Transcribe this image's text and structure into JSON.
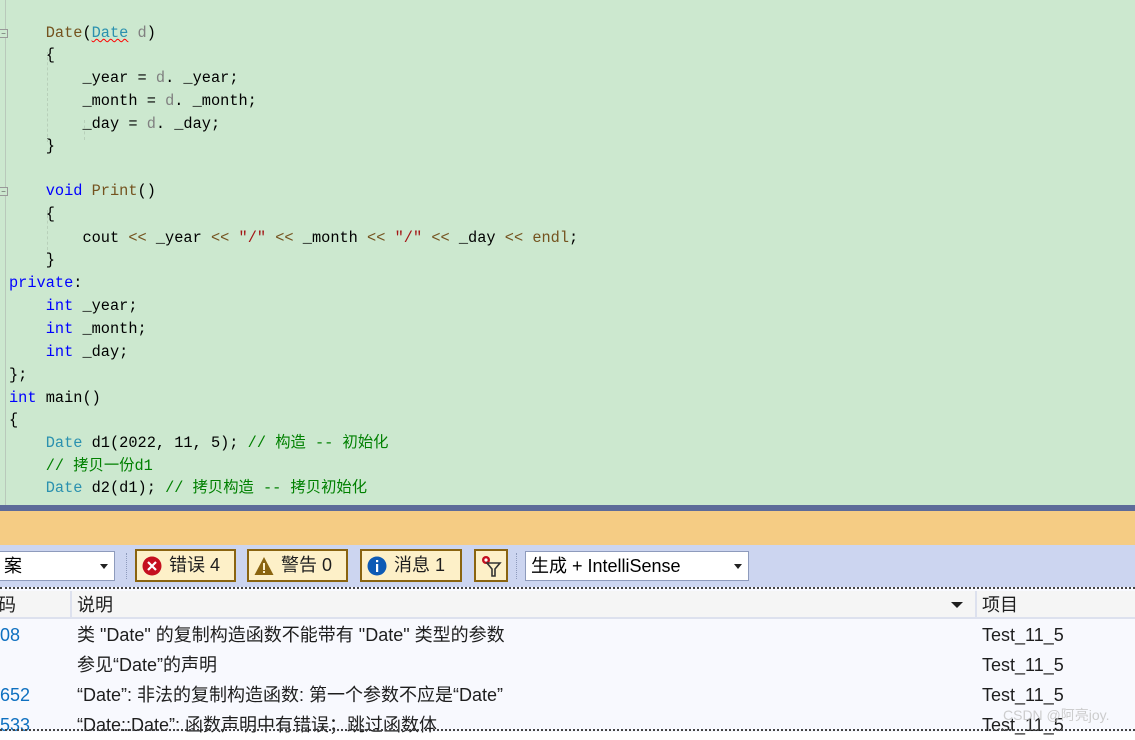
{
  "editor": {
    "lines": [
      {
        "tokens": [
          [
            "fn",
            "Date"
          ],
          [
            "",
            "("
          ],
          [
            "ty squig",
            "Date"
          ],
          [
            "pa",
            " d"
          ],
          [
            "",
            ")"
          ]
        ],
        "indent": "    "
      },
      {
        "tokens": [
          [
            "",
            "{"
          ]
        ],
        "indent": "    "
      },
      {
        "tokens": [
          [
            "",
            "_year = "
          ],
          [
            "pa",
            "d"
          ],
          [
            "",
            ". _year;"
          ]
        ],
        "indent": "        "
      },
      {
        "tokens": [
          [
            "",
            "_month = "
          ],
          [
            "pa",
            "d"
          ],
          [
            "",
            ". _month;"
          ]
        ],
        "indent": "        "
      },
      {
        "tokens": [
          [
            "",
            "_day = "
          ],
          [
            "pa",
            "d"
          ],
          [
            "",
            ". _day;"
          ]
        ],
        "indent": "        "
      },
      {
        "tokens": [
          [
            "",
            "}"
          ]
        ],
        "indent": "    "
      },
      {
        "tokens": [],
        "indent": ""
      },
      {
        "tokens": [
          [
            "kw",
            "void"
          ],
          [
            "",
            " "
          ],
          [
            "fn",
            "Print"
          ],
          [
            "",
            "()"
          ]
        ],
        "indent": "    "
      },
      {
        "tokens": [
          [
            "",
            "{"
          ]
        ],
        "indent": "    "
      },
      {
        "tokens": [
          [
            "",
            "cout "
          ],
          [
            "fn",
            "<<"
          ],
          [
            "",
            " _year "
          ],
          [
            "fn",
            "<<"
          ],
          [
            "",
            " "
          ],
          [
            "st",
            "\"/\""
          ],
          [
            "",
            " "
          ],
          [
            "fn",
            "<<"
          ],
          [
            "",
            " _month "
          ],
          [
            "fn",
            "<<"
          ],
          [
            "",
            " "
          ],
          [
            "st",
            "\"/\""
          ],
          [
            "",
            " "
          ],
          [
            "fn",
            "<<"
          ],
          [
            "",
            " _day "
          ],
          [
            "fn",
            "<<"
          ],
          [
            "",
            " "
          ],
          [
            "fn",
            "endl"
          ],
          [
            "",
            ";"
          ]
        ],
        "indent": "        "
      },
      {
        "tokens": [
          [
            "",
            "}"
          ]
        ],
        "indent": "    "
      },
      {
        "tokens": [
          [
            "kw",
            "private"
          ],
          [
            "",
            ":"
          ]
        ],
        "indent": ""
      },
      {
        "tokens": [
          [
            "kw",
            "int"
          ],
          [
            "",
            " _year;"
          ]
        ],
        "indent": "    "
      },
      {
        "tokens": [
          [
            "kw",
            "int"
          ],
          [
            "",
            " _month;"
          ]
        ],
        "indent": "    "
      },
      {
        "tokens": [
          [
            "kw",
            "int"
          ],
          [
            "",
            " _day;"
          ]
        ],
        "indent": "    "
      },
      {
        "tokens": [
          [
            "",
            "};"
          ]
        ],
        "indent": ""
      },
      {
        "tokens": [
          [
            "kw",
            "int"
          ],
          [
            "",
            " main()"
          ]
        ],
        "indent": ""
      },
      {
        "tokens": [
          [
            "",
            "{"
          ]
        ],
        "indent": ""
      },
      {
        "tokens": [
          [
            "ty",
            "Date"
          ],
          [
            "",
            " d1(2022, 11, 5); "
          ],
          [
            "cm",
            "// 构造 -- 初始化"
          ]
        ],
        "indent": "    "
      },
      {
        "tokens": [
          [
            "cm",
            "// 拷贝一份d1"
          ]
        ],
        "indent": "    "
      },
      {
        "tokens": [
          [
            "ty",
            "Date"
          ],
          [
            "",
            " d2(d1); "
          ],
          [
            "cm",
            "// 拷贝构造 -- 拷贝初始化"
          ]
        ],
        "indent": "    "
      }
    ]
  },
  "toolbar": {
    "scope_value": "案",
    "errors_label": "错误 4",
    "warnings_label": "警告 0",
    "messages_label": "消息 1",
    "source_value": "生成 + IntelliSense"
  },
  "table": {
    "headers": {
      "code": "码",
      "description": "说明",
      "project": "项目"
    },
    "rows": [
      {
        "code": "08",
        "description": "类 \"Date\" 的复制构造函数不能带有 \"Date\" 类型的参数",
        "project": "Test_11_5"
      },
      {
        "code": "",
        "description": "参见“Date”的声明",
        "project": "Test_11_5"
      },
      {
        "code": "652",
        "description": "“Date”: 非法的复制构造函数: 第一个参数不应是“Date”",
        "project": "Test_11_5"
      },
      {
        "code": "533",
        "description": "“Date::Date”: 函数声明中有错误；跳过函数体",
        "project": "Test_11_5"
      }
    ]
  },
  "watermark": "CSDN @阿亮joy.",
  "colors": {
    "editor_bg": "#cce8cf",
    "error": "#c50f1f",
    "warning": "#8a6410",
    "info": "#0e5bb5"
  }
}
